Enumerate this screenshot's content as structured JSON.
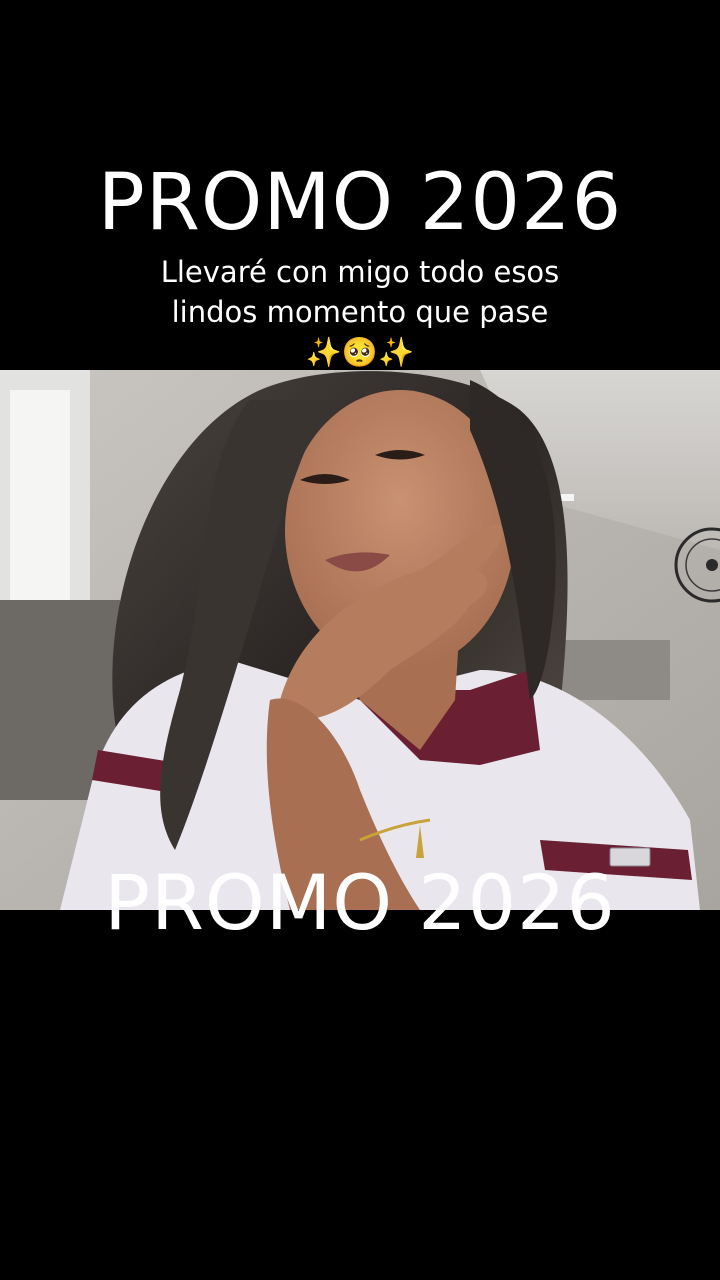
{
  "overlay": {
    "title_top": "PROMO 2026",
    "caption_line1": "Llevaré con migo todo esos",
    "caption_line2": "lindos momento que pase",
    "caption_emoji": "✨🥺✨",
    "title_bottom": "PROMO 2026"
  },
  "colors": {
    "background": "#000000",
    "text": "#ffffff",
    "uniform_shirt": "#e9e6ee",
    "uniform_collar": "#6b1f33"
  }
}
